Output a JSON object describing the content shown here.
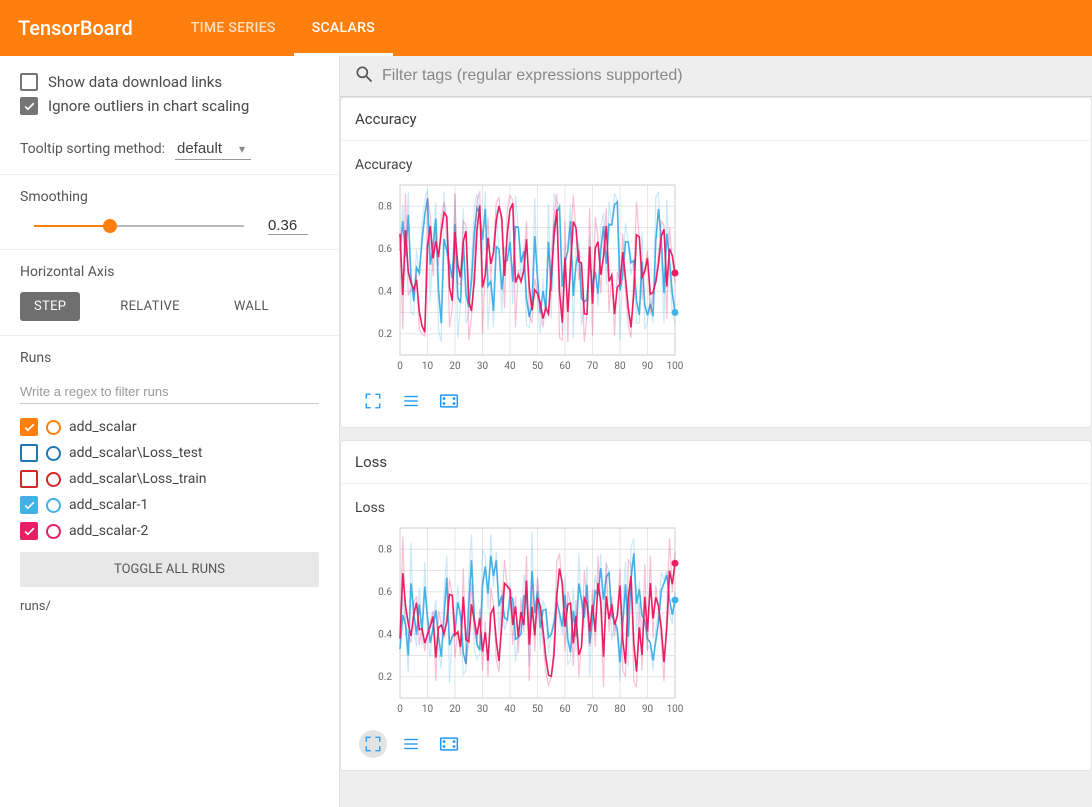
{
  "header": {
    "logo": "TensorBoard",
    "tabs": [
      {
        "label": "TIME SERIES",
        "active": false
      },
      {
        "label": "SCALARS",
        "active": true
      }
    ]
  },
  "sidebar": {
    "options": [
      {
        "label": "Show data download links",
        "checked": false
      },
      {
        "label": "Ignore outliers in chart scaling",
        "checked": true
      }
    ],
    "tooltip_label": "Tooltip sorting method:",
    "tooltip_value": "default",
    "smoothing": {
      "label": "Smoothing",
      "value": "0.36",
      "percent": 36
    },
    "horizontal": {
      "label": "Horizontal Axis",
      "buttons": [
        {
          "label": "STEP",
          "active": true
        },
        {
          "label": "RELATIVE",
          "active": false
        },
        {
          "label": "WALL",
          "active": false
        }
      ]
    },
    "runs": {
      "label": "Runs",
      "placeholder": "Write a regex to filter runs",
      "items": [
        {
          "label": "add_scalar",
          "color": "#ff7f0e",
          "checked": true
        },
        {
          "label": "add_scalar\\Loss_test",
          "color": "#1f77b4",
          "checked": false
        },
        {
          "label": "add_scalar\\Loss_train",
          "color": "#d62728",
          "checked": false
        },
        {
          "label": "add_scalar-1",
          "color": "#43b0e8",
          "checked": true
        },
        {
          "label": "add_scalar-2",
          "color": "#e91e63",
          "checked": true
        }
      ],
      "toggle": "TOGGLE ALL RUNS",
      "path": "runs/"
    }
  },
  "main": {
    "search_placeholder": "Filter tags (regular expressions supported)",
    "cards": [
      {
        "title": "Accuracy",
        "chart_key": 0,
        "fullscreen_active": false
      },
      {
        "title": "Loss",
        "chart_key": 1,
        "fullscreen_active": true
      }
    ]
  },
  "chart_data": [
    {
      "type": "line",
      "title": "Accuracy",
      "xlabel": "",
      "ylabel": "",
      "xlim": [
        0,
        100
      ],
      "ylim": [
        0.1,
        0.9
      ],
      "xticks": [
        0,
        10,
        20,
        30,
        40,
        50,
        60,
        70,
        80,
        90,
        100
      ],
      "yticks": [
        0.2,
        0.4,
        0.6,
        0.8
      ],
      "series": [
        {
          "name": "add_scalar-1",
          "color": "#43b0e8",
          "values": [
            0.59,
            0.81,
            0.47,
            0.87,
            0.3,
            0.29,
            0.6,
            0.47,
            0.72,
            0.83,
            0.88,
            0.35,
            0.65,
            0.82,
            0.22,
            0.16,
            0.87,
            0.56,
            0.5,
            0.42,
            0.86,
            0.18,
            0.33,
            0.79,
            0.25,
            0.29,
            0.52,
            0.8,
            0.86,
            0.75,
            0.57,
            0.87,
            0.22,
            0.46,
            0.23,
            0.78,
            0.59,
            0.3,
            0.61,
            0.55,
            0.68,
            0.34,
            0.85,
            0.7,
            0.44,
            0.62,
            0.24,
            0.23,
            0.37,
            0.84,
            0.36,
            0.2,
            0.46,
            0.27,
            0.81,
            0.27,
            0.86,
            0.82,
            0.81,
            0.21,
            0.6,
            0.62,
            0.81,
            0.18,
            0.61,
            0.63,
            0.24,
            0.34,
            0.37,
            0.66,
            0.35,
            0.53,
            0.33,
            0.71,
            0.77,
            0.43,
            0.82,
            0.71,
            0.86,
            0.83,
            0.17,
            0.52,
            0.72,
            0.63,
            0.48,
            0.55,
            0.25,
            0.25,
            0.68,
            0.22,
            0.26,
            0.37,
            0.25,
            0.84,
            0.87,
            0.56,
            0.25,
            0.83,
            0.48,
            0.3,
            0.25
          ]
        },
        {
          "name": "add_scalar-2",
          "color": "#e91e63",
          "values": [
            0.67,
            0.22,
            0.86,
            0.38,
            0.41,
            0.39,
            0.48,
            0.22,
            0.2,
            0.19,
            0.84,
            0.76,
            0.47,
            0.68,
            0.52,
            0.75,
            0.82,
            0.74,
            0.23,
            0.32,
            0.86,
            0.44,
            0.43,
            0.73,
            0.71,
            0.17,
            0.28,
            0.53,
            0.82,
            0.87,
            0.2,
            0.51,
            0.75,
            0.46,
            0.61,
            0.82,
            0.84,
            0.71,
            0.32,
            0.78,
            0.85,
            0.83,
            0.23,
            0.5,
            0.43,
            0.52,
            0.73,
            0.29,
            0.25,
            0.46,
            0.38,
            0.32,
            0.23,
            0.35,
            0.28,
            0.58,
            0.75,
            0.86,
            0.18,
            0.17,
            0.73,
            0.16,
            0.63,
            0.85,
            0.68,
            0.45,
            0.53,
            0.16,
            0.29,
            0.79,
            0.19,
            0.75,
            0.65,
            0.39,
            0.61,
            0.79,
            0.3,
            0.49,
            0.19,
            0.49,
            0.44,
            0.67,
            0.39,
            0.24,
            0.18,
            0.48,
            0.82,
            0.65,
            0.36,
            0.51,
            0.59,
            0.29,
            0.4,
            0.47,
            0.58,
            0.73,
            0.71,
            0.27,
            0.7,
            0.55,
            0.44
          ]
        }
      ]
    },
    {
      "type": "line",
      "title": "Loss",
      "xlabel": "",
      "ylabel": "",
      "xlim": [
        0,
        100
      ],
      "ylim": [
        0.1,
        0.9
      ],
      "xticks": [
        0,
        10,
        20,
        30,
        40,
        50,
        60,
        70,
        80,
        90,
        100
      ],
      "yticks": [
        0.2,
        0.4,
        0.6,
        0.8
      ],
      "series": [
        {
          "name": "add_scalar-1",
          "color": "#43b0e8",
          "values": [
            0.33,
            0.58,
            0.42,
            0.22,
            0.83,
            0.42,
            0.34,
            0.62,
            0.35,
            0.74,
            0.4,
            0.29,
            0.47,
            0.56,
            0.32,
            0.24,
            0.59,
            0.77,
            0.17,
            0.41,
            0.42,
            0.63,
            0.46,
            0.21,
            0.23,
            0.69,
            0.87,
            0.33,
            0.28,
            0.31,
            0.8,
            0.77,
            0.52,
            0.87,
            0.62,
            0.79,
            0.41,
            0.61,
            0.42,
            0.46,
            0.64,
            0.56,
            0.27,
            0.39,
            0.41,
            0.68,
            0.59,
            0.25,
            0.88,
            0.39,
            0.66,
            0.33,
            0.56,
            0.52,
            0.31,
            0.41,
            0.48,
            0.61,
            0.47,
            0.4,
            0.67,
            0.26,
            0.28,
            0.62,
            0.32,
            0.78,
            0.52,
            0.43,
            0.72,
            0.2,
            0.53,
            0.68,
            0.58,
            0.78,
            0.48,
            0.73,
            0.7,
            0.37,
            0.45,
            0.4,
            0.18,
            0.55,
            0.74,
            0.25,
            0.81,
            0.85,
            0.41,
            0.65,
            0.42,
            0.45,
            0.33,
            0.35,
            0.23,
            0.42,
            0.51,
            0.69,
            0.66,
            0.7,
            0.5,
            0.45,
            0.6
          ]
        },
        {
          "name": "add_scalar-2",
          "color": "#e91e63",
          "values": [
            0.38,
            0.86,
            0.45,
            0.4,
            0.36,
            0.55,
            0.58,
            0.35,
            0.43,
            0.32,
            0.42,
            0.46,
            0.51,
            0.18,
            0.51,
            0.45,
            0.38,
            0.49,
            0.66,
            0.58,
            0.29,
            0.42,
            0.3,
            0.71,
            0.26,
            0.36,
            0.64,
            0.42,
            0.36,
            0.52,
            0.23,
            0.46,
            0.2,
            0.62,
            0.54,
            0.28,
            0.22,
            0.54,
            0.75,
            0.62,
            0.6,
            0.35,
            0.58,
            0.31,
            0.57,
            0.41,
            0.77,
            0.18,
            0.63,
            0.32,
            0.67,
            0.51,
            0.36,
            0.22,
            0.16,
            0.2,
            0.36,
            0.74,
            0.78,
            0.6,
            0.32,
            0.6,
            0.55,
            0.25,
            0.56,
            0.2,
            0.36,
            0.7,
            0.53,
            0.34,
            0.61,
            0.34,
            0.77,
            0.5,
            0.15,
            0.74,
            0.41,
            0.58,
            0.39,
            0.51,
            0.71,
            0.23,
            0.2,
            0.75,
            0.73,
            0.18,
            0.15,
            0.55,
            0.23,
            0.73,
            0.32,
            0.77,
            0.38,
            0.63,
            0.51,
            0.37,
            0.18,
            0.52,
            0.85,
            0.6,
            0.79
          ]
        }
      ]
    }
  ]
}
